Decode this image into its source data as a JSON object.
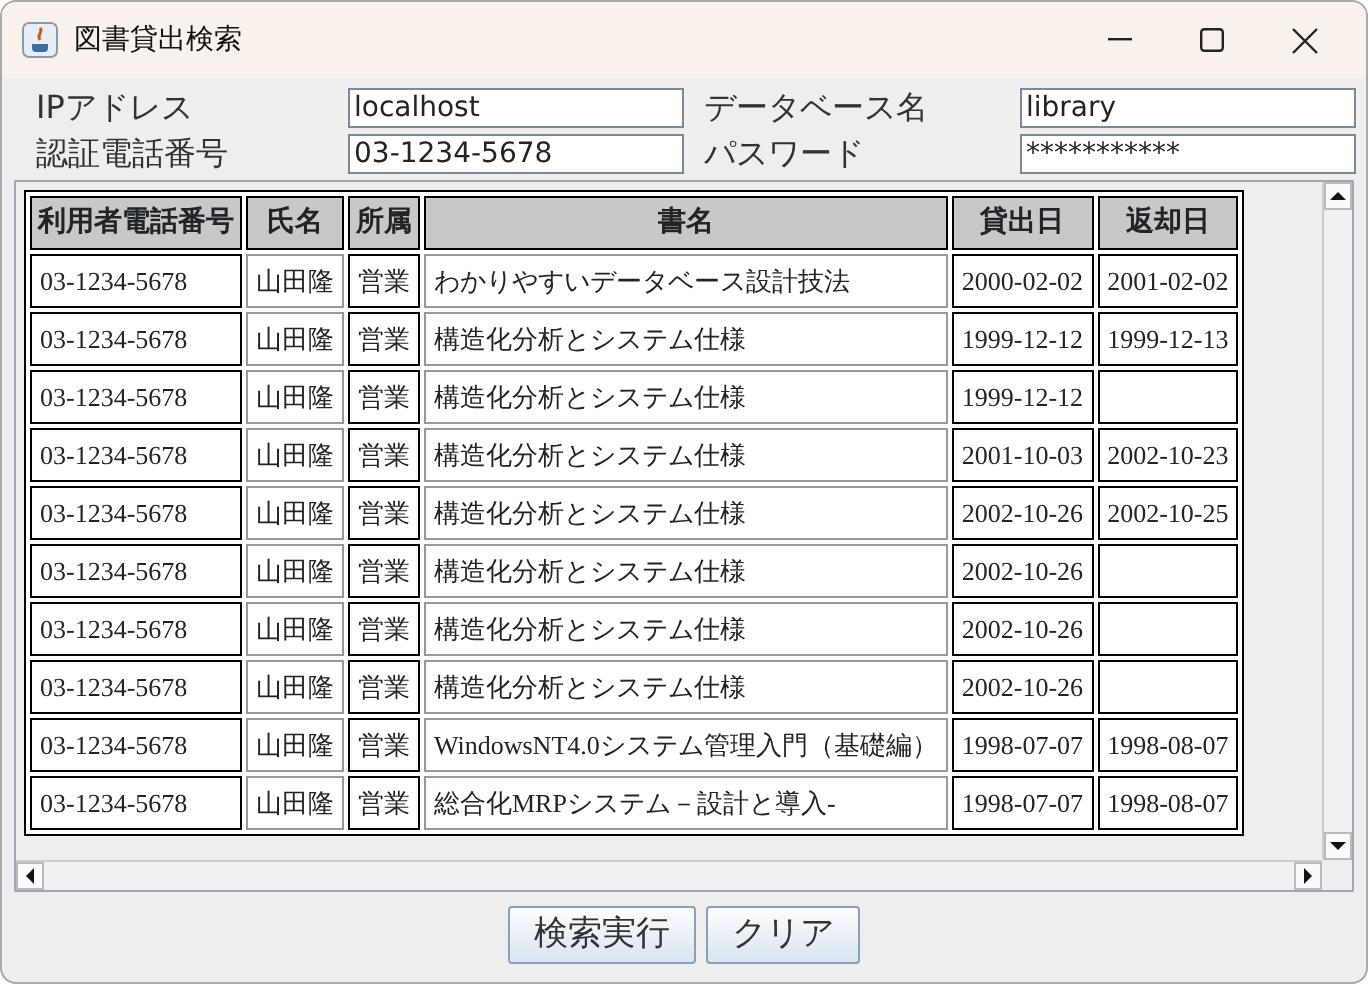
{
  "window": {
    "title": "図書貸出検索"
  },
  "form": [
    {
      "label": "IPアドレス",
      "value": "localhost"
    },
    {
      "label": "データベース名",
      "value": "library"
    },
    {
      "label": "認証電話番号",
      "value": "03-1234-5678"
    },
    {
      "label": "パスワード",
      "value": "***********"
    }
  ],
  "table": {
    "columns": [
      "利用者電話番号",
      "氏名",
      "所属",
      "書名",
      "貸出日",
      "返却日"
    ],
    "rows": [
      [
        "03-1234-5678",
        "山田隆",
        "営業",
        "わかりやすいデータベース設計技法",
        "2000-02-02",
        "2001-02-02"
      ],
      [
        "03-1234-5678",
        "山田隆",
        "営業",
        "構造化分析とシステム仕様",
        "1999-12-12",
        "1999-12-13"
      ],
      [
        "03-1234-5678",
        "山田隆",
        "営業",
        "構造化分析とシステム仕様",
        "1999-12-12",
        ""
      ],
      [
        "03-1234-5678",
        "山田隆",
        "営業",
        "構造化分析とシステム仕様",
        "2001-10-03",
        "2002-10-23"
      ],
      [
        "03-1234-5678",
        "山田隆",
        "営業",
        "構造化分析とシステム仕様",
        "2002-10-26",
        "2002-10-25"
      ],
      [
        "03-1234-5678",
        "山田隆",
        "営業",
        "構造化分析とシステム仕様",
        "2002-10-26",
        ""
      ],
      [
        "03-1234-5678",
        "山田隆",
        "営業",
        "構造化分析とシステム仕様",
        "2002-10-26",
        ""
      ],
      [
        "03-1234-5678",
        "山田隆",
        "営業",
        "構造化分析とシステム仕様",
        "2002-10-26",
        ""
      ],
      [
        "03-1234-5678",
        "山田隆",
        "営業",
        "WindowsNT4.0システム管理入門（基礎編）",
        "1998-07-07",
        "1998-08-07"
      ],
      [
        "03-1234-5678",
        "山田隆",
        "営業",
        "総合化MRPシステム－設計と導入-",
        "1998-07-07",
        "1998-08-07"
      ]
    ]
  },
  "buttons": [
    "検索実行",
    "クリア"
  ]
}
